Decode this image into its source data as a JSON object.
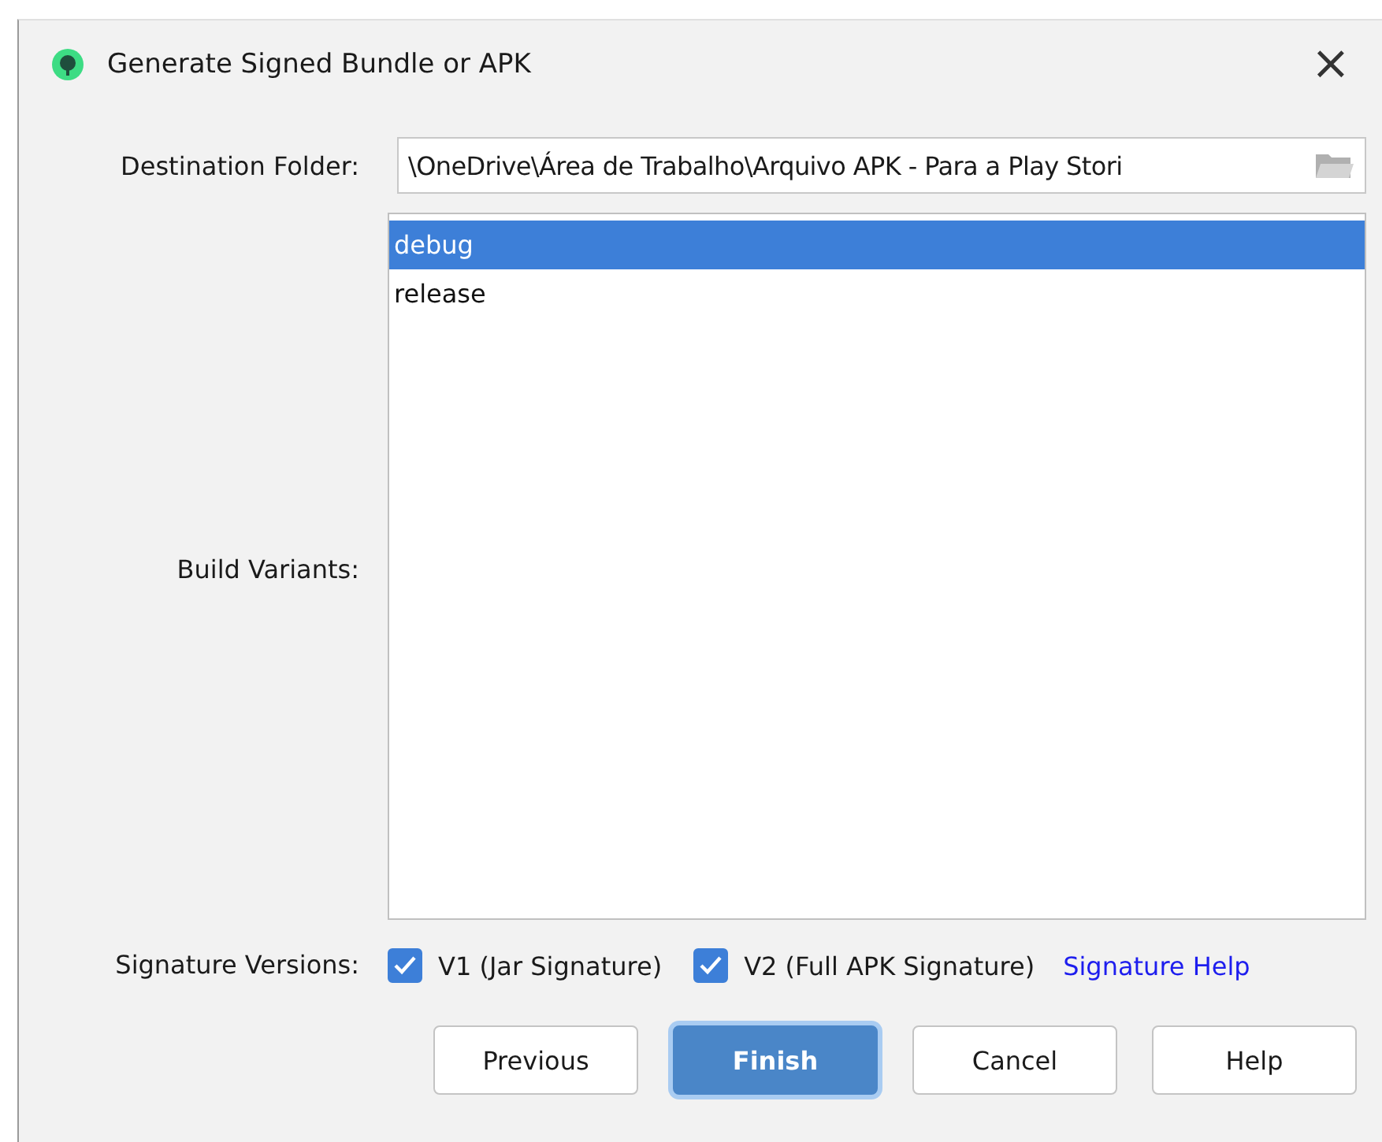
{
  "window": {
    "title": "Generate Signed Bundle or APK",
    "close": "×"
  },
  "destination": {
    "label": "Destination Folder:",
    "value": "\\OneDrive\\Área de Trabalho\\Arquivo APK - Para a Play Stori"
  },
  "variants": {
    "label": "Build Variants:",
    "items": [
      {
        "label": "debug",
        "selected": true
      },
      {
        "label": "release",
        "selected": false
      }
    ]
  },
  "signature": {
    "label": "Signature Versions:",
    "options": [
      {
        "label": "V1 (Jar Signature)",
        "checked": true
      },
      {
        "label": "V2 (Full APK Signature)",
        "checked": true
      }
    ],
    "help_link": "Signature Help"
  },
  "buttons": [
    {
      "label": "Previous",
      "default": false
    },
    {
      "label": "Finish",
      "default": true
    },
    {
      "label": "Cancel",
      "default": false
    },
    {
      "label": "Help",
      "default": false
    }
  ]
}
